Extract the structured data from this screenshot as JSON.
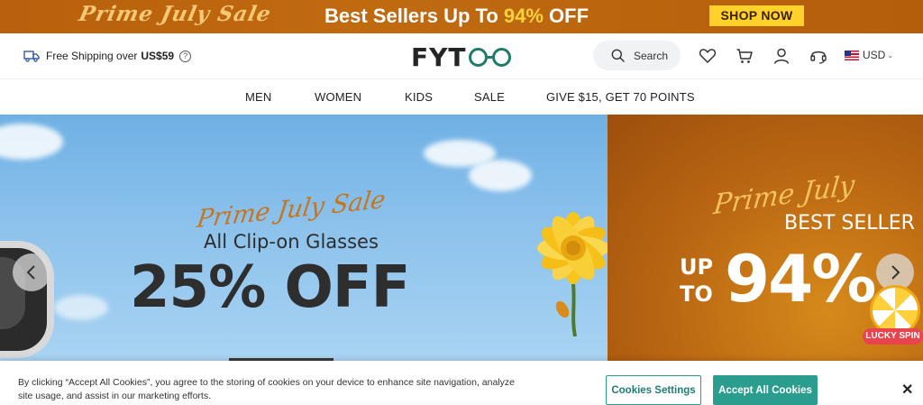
{
  "promo": {
    "script_text": "Prime July Sale",
    "headline_prefix": "Best Sellers Up To ",
    "headline_highlight": "94%",
    "headline_suffix": " OFF",
    "button_label": "SHOP NOW"
  },
  "header": {
    "shipping_text": "Free Shipping over",
    "shipping_amount": "US$59",
    "logo_text_a": "FYT",
    "search_placeholder": "Search",
    "currency": "USD",
    "icons": [
      "truck-icon",
      "question-icon",
      "search-icon",
      "heart-icon",
      "cart-icon",
      "user-icon",
      "headset-icon",
      "us-flag-icon"
    ]
  },
  "nav": {
    "items": [
      "MEN",
      "WOMEN",
      "KIDS",
      "SALE",
      "GIVE $15, GET 70 POINTS"
    ]
  },
  "hero": {
    "slide_a": {
      "script_text": "Prime July Sale",
      "subtitle": "All Clip-on Glasses",
      "headline": "25% OFF"
    },
    "slide_b": {
      "script_text": "Prime July",
      "subtitle": "BEST SELLER",
      "upto_line1": "UP",
      "upto_line2": "TO",
      "headline": "94%"
    },
    "lucky_spin_label": "LUCKY SPIN"
  },
  "cookie": {
    "text": "By clicking “Accept All Cookies”, you agree to the storing of cookies on your device to enhance site navigation, analyze site usage, and assist in our marketing efforts.",
    "settings_label": "Cookies Settings",
    "accept_label": "Accept All Cookies",
    "close_label": "✕"
  },
  "colors": {
    "brand_teal": "#1f7a6b",
    "accept_button": "#2a9d8f",
    "promo_bg": "#b8600d",
    "shop_now_bg": "#ffd12a"
  }
}
